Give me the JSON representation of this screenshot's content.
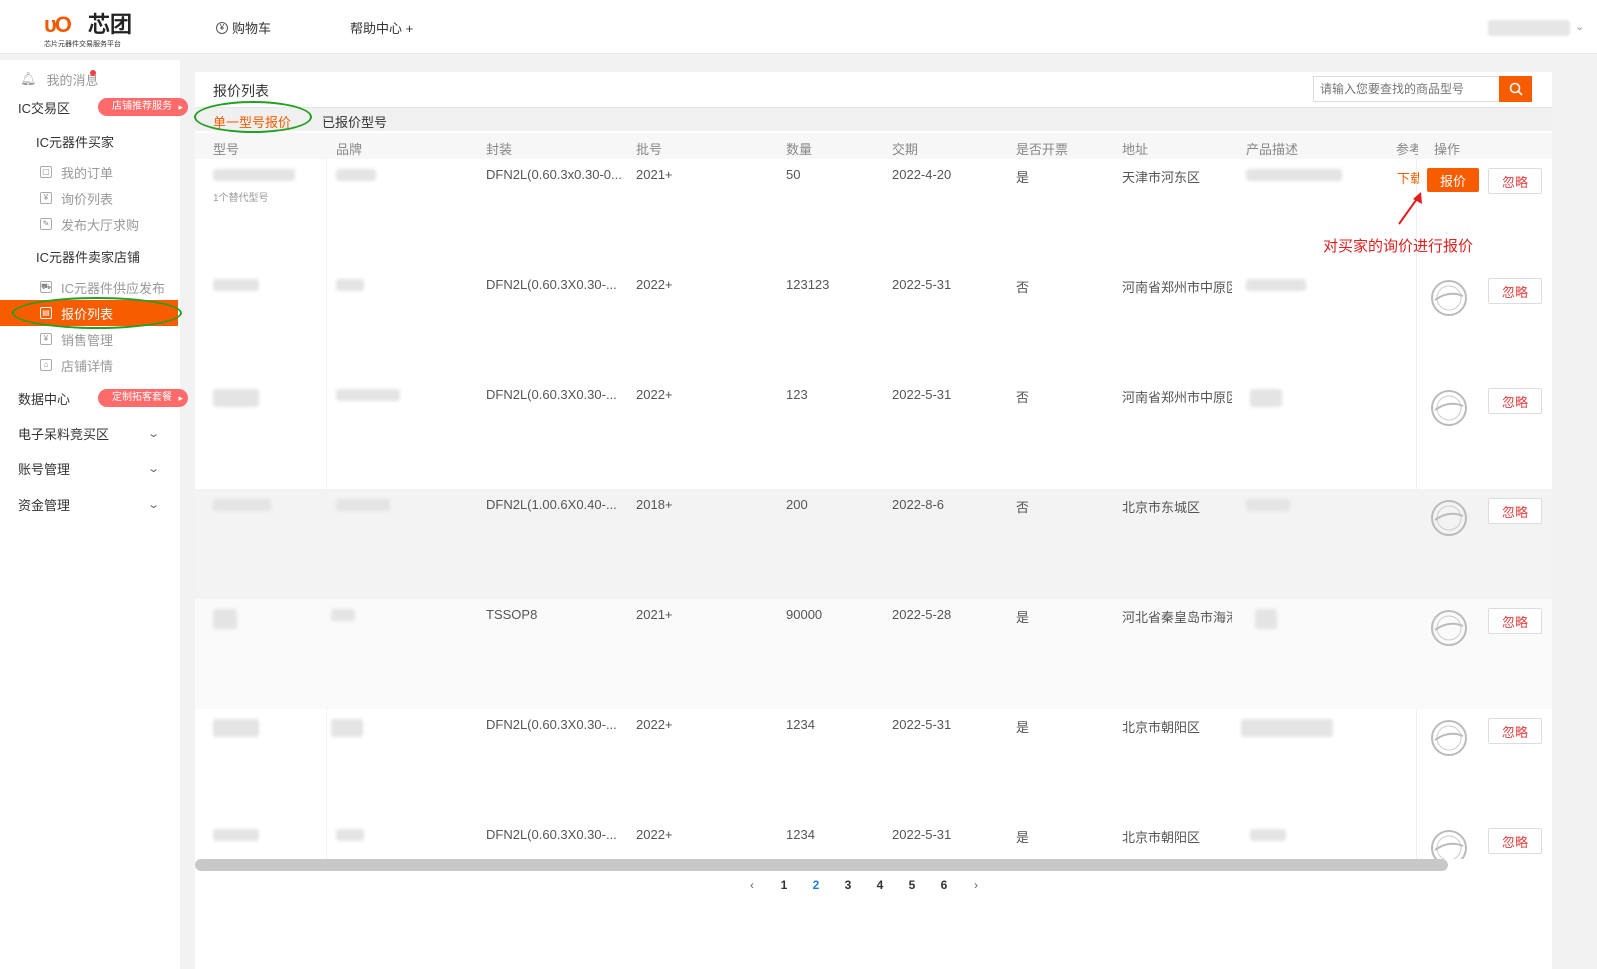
{
  "header": {
    "logo_mark": "ᴜO",
    "logo_name": "芯团",
    "logo_sub": "芯片元器件交易服务平台",
    "nav_cart": "购物车",
    "nav_help": "帮助中心 +"
  },
  "sidebar": {
    "messages": "我的消息",
    "ic_zone": "IC交易区",
    "ic_zone_tag": "店铺推荐服务",
    "buyer": "IC元器件买家",
    "my_orders": "我的订单",
    "inquiry_list": "询价列表",
    "publish_hall": "发布大厅求购",
    "seller": "IC元器件卖家店铺",
    "supply_publish": "IC元器件供应发布",
    "quote_list": "报价列表",
    "sales_mgmt": "销售管理",
    "shop_detail": "店铺详情",
    "data_center": "数据中心",
    "data_tag": "定制拓客套餐",
    "e_bidding": "电子呆料竞买区",
    "account": "账号管理",
    "funds": "资金管理"
  },
  "main": {
    "title": "报价列表",
    "search_placeholder": "请输入您要查找的商品型号",
    "tab_single": "单一型号报价",
    "tab_quoted": "已报价型号",
    "columns": [
      "型号",
      "品牌",
      "封装",
      "批号",
      "数量",
      "交期",
      "是否开票",
      "地址",
      "产品描述",
      "参考",
      "操作"
    ],
    "alt_model_text": "1个替代型号",
    "ref_download": "下载",
    "quote_btn": "报价",
    "ignore_btn": "忽略",
    "stamp_text": "已报价",
    "annotation": "对买家的询价进行报价"
  },
  "rows": [
    {
      "package": "DFN2L(0.60.3x0.30-0...",
      "batch": "2021+",
      "qty": "50",
      "delivery": "2022-4-20",
      "invoice": "是",
      "address": "天津市河东区"
    },
    {
      "package": "DFN2L(0.60.3X0.30-...",
      "batch": "2022+",
      "qty": "123123",
      "delivery": "2022-5-31",
      "invoice": "否",
      "address": "河南省郑州市中原区"
    },
    {
      "package": "DFN2L(0.60.3X0.30-...",
      "batch": "2022+",
      "qty": "123",
      "delivery": "2022-5-31",
      "invoice": "否",
      "address": "河南省郑州市中原区"
    },
    {
      "package": "DFN2L(1.00.6X0.40-...",
      "batch": "2018+",
      "qty": "200",
      "delivery": "2022-8-6",
      "invoice": "否",
      "address": "北京市东城区"
    },
    {
      "package": "TSSOP8",
      "batch": "2021+",
      "qty": "90000",
      "delivery": "2022-5-28",
      "invoice": "是",
      "address": "河北省秦皇岛市海港"
    },
    {
      "package": "DFN2L(0.60.3X0.30-...",
      "batch": "2022+",
      "qty": "1234",
      "delivery": "2022-5-31",
      "invoice": "是",
      "address": "北京市朝阳区"
    },
    {
      "package": "DFN2L(0.60.3X0.30-...",
      "batch": "2022+",
      "qty": "1234",
      "delivery": "2022-5-31",
      "invoice": "是",
      "address": "北京市朝阳区"
    }
  ],
  "pagination": {
    "prev": "‹",
    "pages": [
      "1",
      "2",
      "3",
      "4",
      "5",
      "6"
    ],
    "current": "2",
    "next": "›"
  },
  "colors": {
    "accent": "#f85c00",
    "highlight_ring": "#22a022",
    "annotation": "#e02020",
    "link": "#1e7ad8"
  }
}
